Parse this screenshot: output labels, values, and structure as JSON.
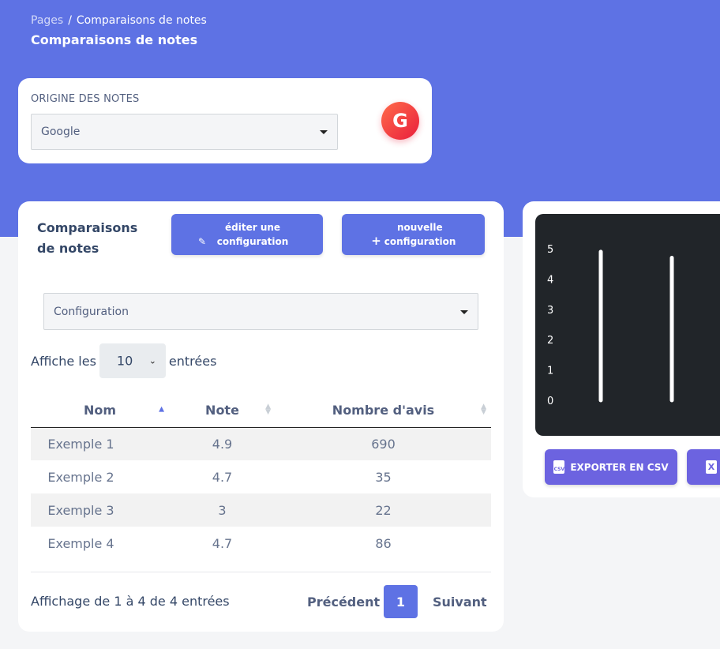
{
  "breadcrumb": {
    "root": "Pages",
    "separator": "/",
    "current": "Comparaisons de notes"
  },
  "page_title": "Comparaisons de notes",
  "source": {
    "label": "ORIGINE DES NOTES",
    "selected": "Google",
    "badge_letter": "G",
    "badge_icon": "google-icon"
  },
  "table_card": {
    "title": "Comparaisons de notes",
    "edit_button": "éditer une configuration",
    "new_button": "nouvelle configuration",
    "config_select": "Configuration",
    "show_prefix": "Affiche les",
    "show_value": "10",
    "show_suffix": "entrées",
    "columns": [
      "Nom",
      "Note",
      "Nombre d'avis"
    ],
    "rows": [
      [
        "Exemple 1",
        "4.9",
        "690"
      ],
      [
        "Exemple 2",
        "4.7",
        "35"
      ],
      [
        "Exemple 3",
        "3",
        "22"
      ],
      [
        "Exemple 4",
        "4.7",
        "86"
      ]
    ],
    "info": "Affichage de 1 à 4 de 4 entrées",
    "pagination": {
      "prev": "Précédent",
      "page": "1",
      "next": "Suivant"
    }
  },
  "chart_card": {
    "export_csv": "EXPORTER EN CSV",
    "csv_icon_text": "CSV",
    "xls_icon_text": "X"
  },
  "chart_data": {
    "type": "bar",
    "categories": [
      "Exemple 1",
      "Exemple 2"
    ],
    "values": [
      4.9,
      4.7
    ],
    "yticks": [
      "0",
      "1",
      "2",
      "3",
      "4",
      "5"
    ],
    "ylim": [
      0,
      5
    ],
    "background": "#212529",
    "bar_color": "#ffffff"
  },
  "colors": {
    "primary": "#5e72e4",
    "export": "#6c63e0",
    "badge": "#e91e3c"
  }
}
